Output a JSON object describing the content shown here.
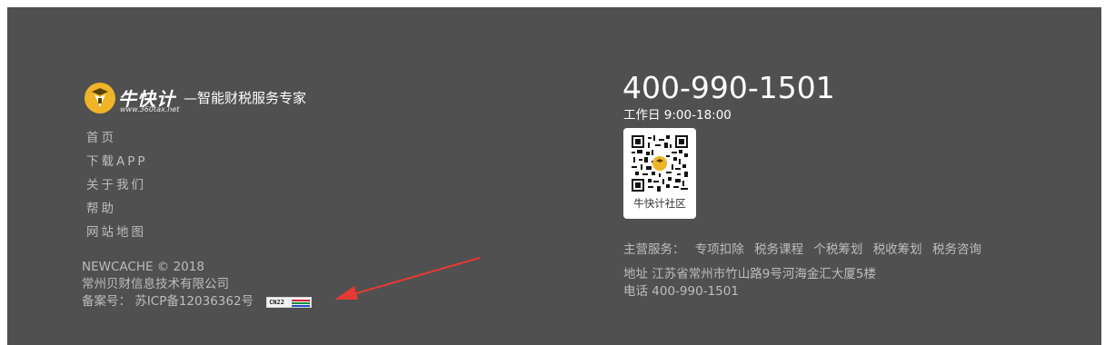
{
  "logo": {
    "name": "牛快计",
    "url": "www.360tax.net",
    "slogan": "—智能财税服务专家"
  },
  "nav": {
    "items": [
      "首页",
      "下载APP",
      "关于我们",
      "帮助",
      "网站地图"
    ]
  },
  "copyright": {
    "line1": "NEWCACHE © 2018",
    "company": "常州贝财信息技术有限公司",
    "icp": "备案号： 苏ICP备12036362号",
    "badge_text": "CN22"
  },
  "contact": {
    "phone_big": "400-990-1501",
    "work_hours": "工作日 9:00-18:00",
    "qr_label": "牛快计社区",
    "services_label": "主营服务：",
    "services": [
      "专项扣除",
      "税务课程",
      "个税筹划",
      "税收筹划",
      "税务咨询"
    ],
    "address": "地址 江苏省常州市竹山路9号河海金汇大厦5楼",
    "phone_line": "电话 400-990-1501"
  },
  "colors": {
    "footer_bg": "#505050",
    "text_muted": "#bdbdbd",
    "logo_gold": "#f0b429",
    "arrow_red": "#e53935"
  }
}
